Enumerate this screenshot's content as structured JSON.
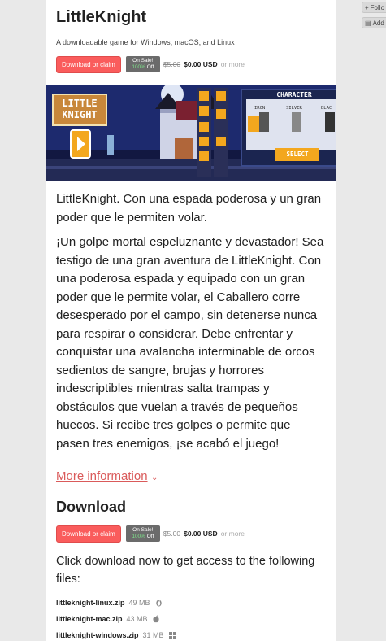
{
  "side_tools": {
    "follow": "Follo",
    "add": "Add"
  },
  "game": {
    "title": "LittleKnight",
    "subtitle": "A downloadable game for Windows, macOS, and Linux"
  },
  "purchase": {
    "button": "Download or claim",
    "sale_label": "On Sale!",
    "sale_pct": "100%",
    "sale_off": "Off",
    "old_price": "$5.00",
    "new_price": "$0.00 USD",
    "or_more": "or more"
  },
  "screenshot": {
    "logo_line1": "LITTLE",
    "logo_line2": "KNIGHT",
    "panel_title": "CHARACTER",
    "char_iron": "IRON",
    "char_silver": "SILVER",
    "char_black": "BLAC",
    "select_label": "SELECT"
  },
  "description": {
    "intro": "LittleKnight. Con una espada poderosa y un gran poder que le permiten volar.",
    "body": "¡Un golpe mortal espeluznante y devastador! Sea testigo de una gran aventura de LittleKnight. Con una poderosa espada y equipado con un gran poder que le permite volar, el Caballero corre desesperado por el campo, sin detenerse nunca para respirar o considerar. Debe enfrentar y conquistar una avalancha interminable de orcos sedientos de sangre, brujas y horrores indescriptibles mientras salta trampas y obstáculos que vuelan a través de pequeños huecos. Si recibe tres golpes o permite que pasen tres enemigos, ¡se acabó el juego!",
    "more_link": "More information"
  },
  "download": {
    "heading": "Download",
    "intro": "Click download now to get access to the following files:",
    "files": [
      {
        "name": "littleknight-linux.zip",
        "size": "49 MB",
        "platform_icon": "linux-icon"
      },
      {
        "name": "littleknight-mac.zip",
        "size": "43 MB",
        "platform_icon": "apple-icon"
      },
      {
        "name": "littleknight-windows.zip",
        "size": "31 MB",
        "platform_icon": "windows-icon"
      }
    ]
  }
}
